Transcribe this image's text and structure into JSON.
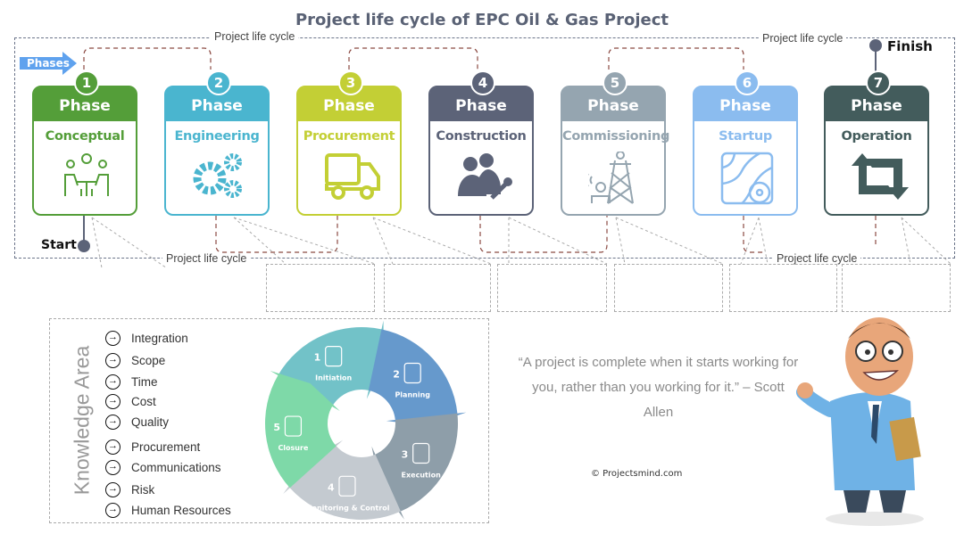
{
  "title": "Project life cycle of EPC Oil & Gas Project",
  "life_cycle_label": "Project life cycle",
  "phases_arrow": "Phases",
  "start": "Start",
  "finish": "Finish",
  "phase_word": "Phase",
  "phases": [
    {
      "num": "1",
      "name": "Conceptual",
      "color": "#549e39",
      "icon": "meeting-idea-icon"
    },
    {
      "num": "2",
      "name": "Engineering",
      "color": "#4ab5cf",
      "icon": "gears-icon"
    },
    {
      "num": "3",
      "name": "Procurement",
      "color": "#c3cf35",
      "icon": "truck-icon"
    },
    {
      "num": "4",
      "name": "Construction",
      "color": "#5c6378",
      "icon": "workers-wrench-icon"
    },
    {
      "num": "5",
      "name": "Commissioning",
      "color": "#95a5b0",
      "icon": "tower-icon"
    },
    {
      "num": "6",
      "name": "Startup",
      "color": "#8bbcef",
      "icon": "map-gear-icon"
    },
    {
      "num": "7",
      "name": "Operation",
      "color": "#435c5c",
      "icon": "repeat-arrows-icon"
    }
  ],
  "knowledge_area": {
    "title": "Knowledge Area",
    "items": [
      "Integration",
      "Scope",
      "Time",
      "Cost",
      "Quality",
      "Procurement",
      "Communications",
      "Risk",
      "Human Resources"
    ]
  },
  "cycle": [
    {
      "num": "1",
      "label": "Initiation",
      "color": "#72c2c8"
    },
    {
      "num": "2",
      "label": "Planning",
      "color": "#6699cc"
    },
    {
      "num": "3",
      "label": "Execution",
      "color": "#8e9ea9"
    },
    {
      "num": "4",
      "label": "Monitoring & Control",
      "color": "#c4cad0"
    },
    {
      "num": "5",
      "label": "Closure",
      "color": "#7ed9a8"
    }
  ],
  "quote": "“A project is complete when it starts working for you, rather than you working for it.” – Scott Allen",
  "copyright": "© Projectsmind.com"
}
